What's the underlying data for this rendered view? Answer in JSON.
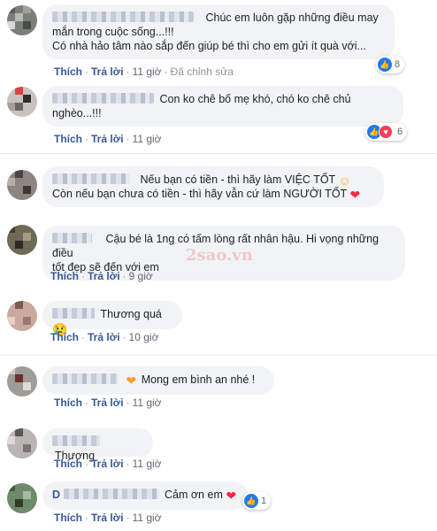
{
  "actions": {
    "like": "Thích",
    "reply": "Trả lời",
    "sep": "·"
  },
  "comments": [
    {
      "text1": "Chúc em luôn gặp những điều may",
      "text2": "mắn trong cuộc sống...!!!",
      "text3": "Có nhà hảo tâm nào sắp đến giúp bé thì cho em gửi ít quà với...",
      "time": "11 giờ",
      "edited": "Đã chỉnh sửa",
      "reaction_count": "8"
    },
    {
      "text1": "Con ko chê bố mẹ khó, chó ko chê chủ",
      "text2": "nghèo...!!!",
      "time": "11 giờ",
      "reaction_count": "6"
    },
    {
      "text1": "Nếu bạn có tiền - thì hãy làm VIỆC TỐT",
      "text2": "Còn nếu bạn chưa có tiền - thì hãy vẫn cứ làm NGƯỜI TỐT",
      "time": "11 giờ"
    },
    {
      "text1": "Cậu bé là 1ng có tấm lòng rất nhân hậu. Hi vọng những điều",
      "text2": "tốt đẹp sẽ đến với em",
      "time": "9 giờ"
    },
    {
      "text1": "Thương quá",
      "time": "10 giờ"
    },
    {
      "text1": "Mong em bình an nhé !",
      "time": "11 giờ"
    },
    {
      "text1": "Thương",
      "time": "11 giờ"
    },
    {
      "name_initial": "D",
      "text1": "Cảm ơn em",
      "time": "11 giờ",
      "reaction_count": "1"
    }
  ],
  "watermark": "2sao.vn",
  "icons": {
    "like": "like-icon",
    "love": "love-icon",
    "smile": "smile-emoji",
    "heart": "heart-emoji",
    "cry": "crying-emoji",
    "orange-heart": "orange-heart-emoji"
  }
}
